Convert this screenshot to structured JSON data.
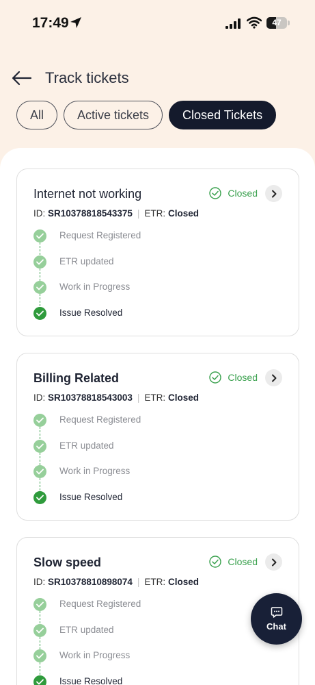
{
  "status_bar": {
    "time": "17:49",
    "battery": "47",
    "battery_level": 0.47
  },
  "header": {
    "title": "Track tickets",
    "back_icon": "arrow-left-icon"
  },
  "tabs": [
    {
      "label": "All",
      "active": false
    },
    {
      "label": "Active tickets",
      "active": false
    },
    {
      "label": "Closed Tickets",
      "active": true
    }
  ],
  "tickets": [
    {
      "title": "Internet not working",
      "status": "Closed",
      "id_label": "ID:",
      "id": "SR10378818543375",
      "etr_label": "ETR:",
      "etr": "Closed",
      "steps": [
        "Request Registered",
        "ETR updated",
        "Work in Progress",
        "Issue Resolved"
      ]
    },
    {
      "title": "Billing Related",
      "status": "Closed",
      "id_label": "ID:",
      "id": "SR10378818543003",
      "etr_label": "ETR:",
      "etr": "Closed",
      "steps": [
        "Request Registered",
        "ETR updated",
        "Work in Progress",
        "Issue Resolved"
      ]
    },
    {
      "title": "Slow speed",
      "status": "Closed",
      "id_label": "ID:",
      "id": "SR10378810898074",
      "etr_label": "ETR:",
      "etr": "Closed",
      "steps": [
        "Request Registered",
        "ETR updated",
        "Work in Progress",
        "Issue Resolved"
      ]
    }
  ],
  "chat": {
    "label": "Chat",
    "icon": "chat-bubble-icon"
  },
  "colors": {
    "accent_dark": "#141a2c",
    "status_green": "#3aa14e",
    "step_green_light": "#96cf9a",
    "step_green_dark": "#2f9b3c",
    "page_bg": "#fcf1e7"
  }
}
